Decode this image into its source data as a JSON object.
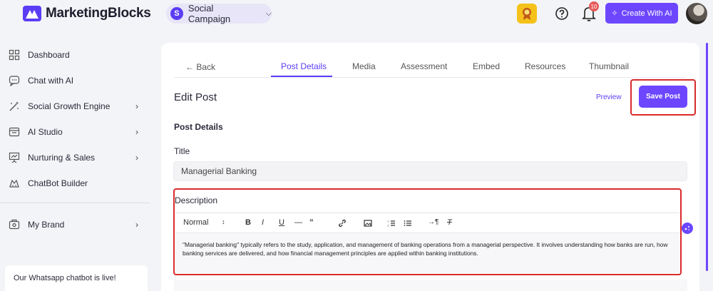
{
  "brand": {
    "name": "MarketingBlocks"
  },
  "campaign": {
    "initial": "S",
    "label": "Social Campaign"
  },
  "header": {
    "notification_count": "10",
    "create_label": "Create With AI"
  },
  "sidebar": {
    "items": [
      {
        "label": "Dashboard",
        "icon": "dashboard-icon",
        "has_submenu": false
      },
      {
        "label": "Chat with AI",
        "icon": "chat-icon",
        "has_submenu": false
      },
      {
        "label": "Social Growth Engine",
        "icon": "magic-wand-icon",
        "has_submenu": true
      },
      {
        "label": "AI Studio",
        "icon": "studio-icon",
        "has_submenu": true
      },
      {
        "label": "Nurturing & Sales",
        "icon": "presentation-icon",
        "has_submenu": true
      },
      {
        "label": "ChatBot Builder",
        "icon": "bot-icon",
        "has_submenu": false
      },
      {
        "label": "My Brand",
        "icon": "brand-icon",
        "has_submenu": true
      }
    ],
    "promo": "Our Whatsapp chatbot is live!"
  },
  "tabs": {
    "back": "← Back",
    "items": [
      "Post Details",
      "Media",
      "Assessment",
      "Embed",
      "Resources",
      "Thumbnail"
    ],
    "active": "Post Details"
  },
  "edit": {
    "title": "Edit Post",
    "preview_label": "Preview",
    "save_label": "Save Post",
    "section_title": "Post Details",
    "title_label": "Title",
    "title_value": "Managerial Banking",
    "description_label": "Description",
    "toolbar": {
      "format": "Normal",
      "bold": "B",
      "italic": "I",
      "underline": "U",
      "strike": "—",
      "quote": "”"
    },
    "description_value": "\"Managerial banking\" typically refers to the study, application, and management of banking operations from a managerial perspective. It involves understanding how banks are run, how banking services are delivered, and how financial management principles are applied within banking institutions."
  },
  "colors": {
    "accent": "#6c47ff",
    "highlight": "#d92b2b",
    "award": "#f4c21a"
  }
}
